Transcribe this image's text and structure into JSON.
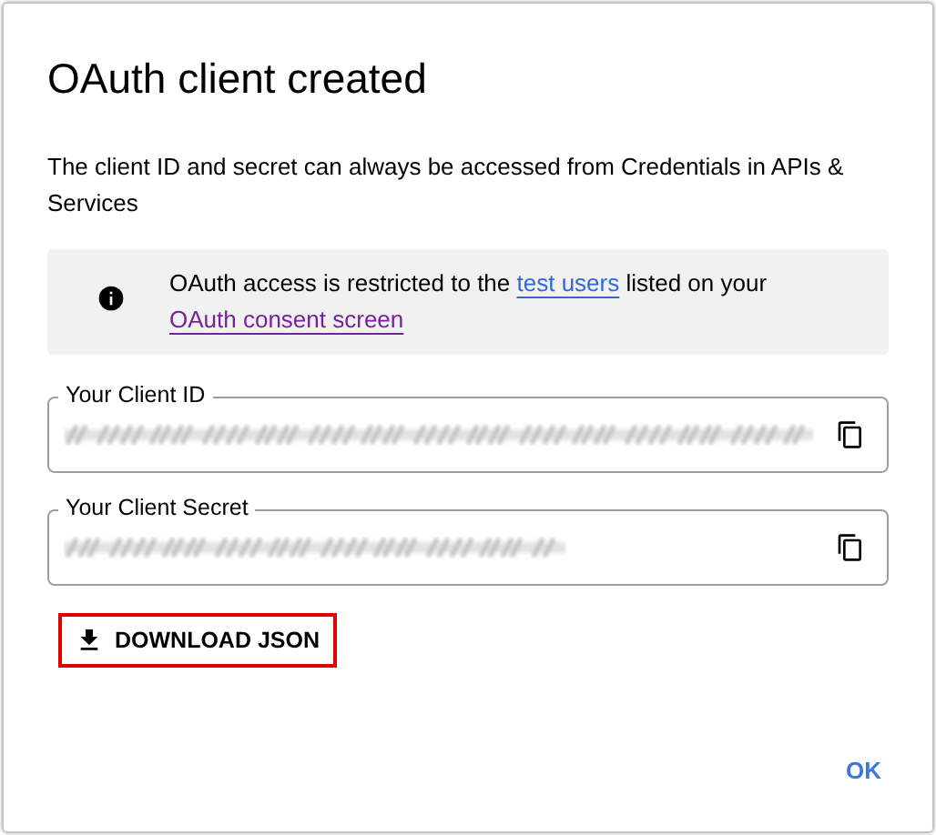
{
  "dialog": {
    "title": "OAuth client created",
    "description": "The client ID and secret can always be accessed from Credentials in APIs & Services",
    "notice": {
      "parts": [
        {
          "kind": "text",
          "text": "OAuth access is restricted to the "
        },
        {
          "kind": "link",
          "text": "test users",
          "visited": false
        },
        {
          "kind": "text",
          "text": " listed on your "
        },
        {
          "kind": "link",
          "text": "OAuth consent screen",
          "visited": true
        }
      ]
    },
    "fields": [
      {
        "label": "Your Client ID",
        "kind": "client_id"
      },
      {
        "label": "Your Client Secret",
        "kind": "client_secret"
      }
    ],
    "download_button": {
      "label": "DOWNLOAD JSON",
      "highlighted": true
    },
    "ok_button": {
      "label": "OK"
    }
  }
}
